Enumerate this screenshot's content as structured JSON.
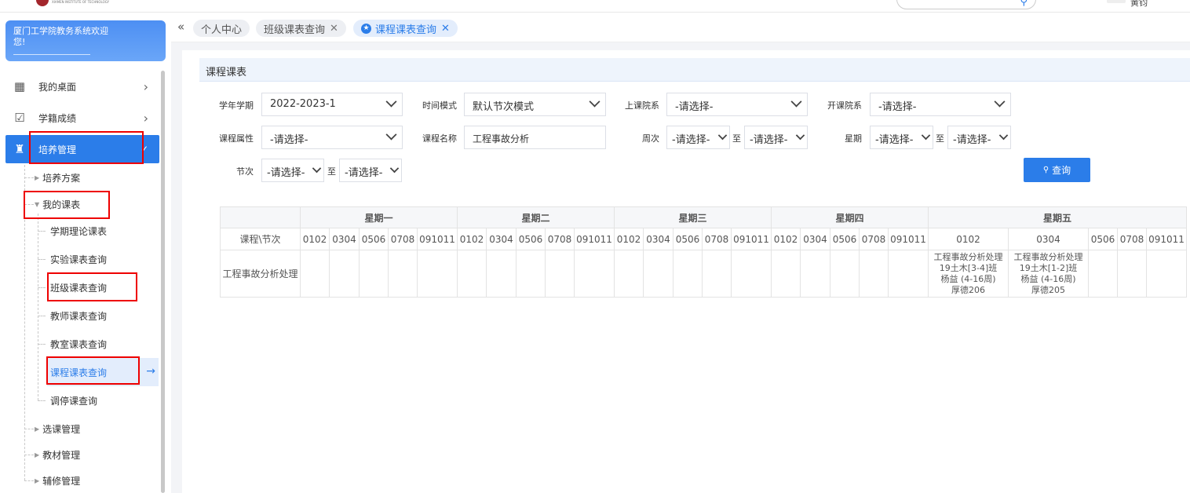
{
  "header": {
    "logo_text": "XIAMEN INSTITUTE OF TECHNOLOGY",
    "username": "黄钧"
  },
  "sidebar": {
    "welcome": "厦门工学院教务系统欢迎您!",
    "items": [
      {
        "label": "我的桌面",
        "icon": "windows-icon"
      },
      {
        "label": "学籍成绩",
        "icon": "checkbox-icon"
      },
      {
        "label": "培养管理",
        "icon": "graduate-icon"
      }
    ],
    "sub": {
      "plan": "培养方案",
      "my_schedule": "我的课表",
      "my_schedule_children": [
        "学期理论课表",
        "实验课表查询",
        "班级课表查询",
        "教师课表查询",
        "教室课表查询",
        "课程课表查询",
        "调停课查询"
      ],
      "course_select": "选课管理",
      "textbook": "教材管理",
      "retake": "辅修管理"
    }
  },
  "tabs": [
    {
      "label": "个人中心"
    },
    {
      "label": "班级课表查询"
    },
    {
      "label": "课程课表查询"
    }
  ],
  "panel_title": "课程课表",
  "form": {
    "term_label": "学年学期",
    "term_value": "2022-2023-1",
    "timemode_label": "时间模式",
    "timemode_value": "默认节次模式",
    "dept_label": "上课院系",
    "dept_value": "-请选择-",
    "opendept_label": "开课院系",
    "opendept_value": "-请选择-",
    "attr_label": "课程属性",
    "attr_value": "-请选择-",
    "name_label": "课程名称",
    "name_value": "工程事故分析",
    "week_label": "周次",
    "week_from": "-请选择-",
    "week_to": "-请选择-",
    "day_label": "星期",
    "day_from": "-请选择-",
    "day_to": "-请选择-",
    "period_label": "节次",
    "period_from": "-请选择-",
    "period_to": "-请选择-",
    "zhi": "至",
    "query_button": "查询"
  },
  "schedule": {
    "days": [
      "星期一",
      "星期二",
      "星期三",
      "星期四",
      "星期五"
    ],
    "corner": "课程\\节次",
    "periods": [
      "0102",
      "0304",
      "0506",
      "0708",
      "091011"
    ],
    "row_name": "工程事故分析处理",
    "fri_0102": [
      "工程事故分析处理",
      "19土木[3-4]班",
      "杨益 (4-16周)",
      "厚德206"
    ],
    "fri_0304": [
      "工程事故分析处理",
      "19土木[1-2]班",
      "杨益 (4-16周)",
      "厚德205"
    ]
  }
}
